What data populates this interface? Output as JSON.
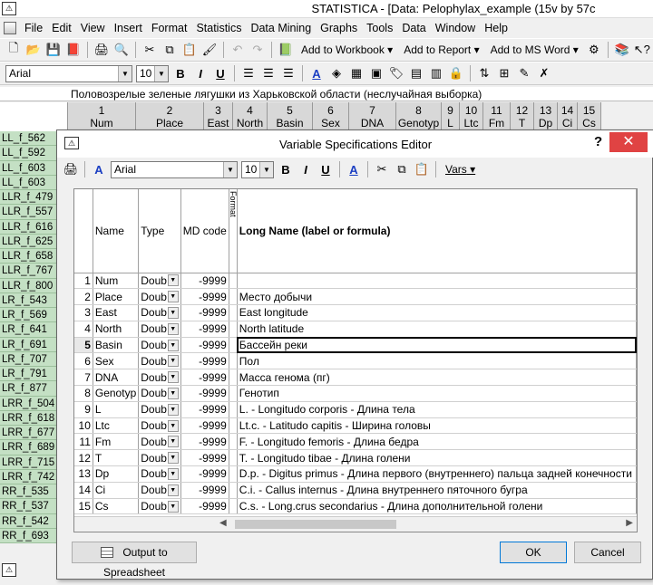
{
  "window": {
    "title": "STATISTICA - [Data: Pelophylax_example (15v by 57c"
  },
  "menu": [
    "File",
    "Edit",
    "View",
    "Insert",
    "Format",
    "Statistics",
    "Data Mining",
    "Graphs",
    "Tools",
    "Data",
    "Window",
    "Help"
  ],
  "toolbar1": {
    "add_workbook": "Add to Workbook",
    "add_report": "Add to Report",
    "add_msword": "Add to MS Word",
    "dropdown_glyph": "▾"
  },
  "toolbar2": {
    "font": "Arial",
    "size": "10",
    "bold": "B",
    "italic": "I",
    "underline": "U",
    "font_color": "A"
  },
  "sheet": {
    "title": "Половозрелые зеленые лягушки из Харьковской области (неслучайная выборка)",
    "columns": [
      {
        "num": "1",
        "name": "Num"
      },
      {
        "num": "2",
        "name": "Place"
      },
      {
        "num": "3",
        "name": "East"
      },
      {
        "num": "4",
        "name": "North"
      },
      {
        "num": "5",
        "name": "Basin"
      },
      {
        "num": "6",
        "name": "Sex"
      },
      {
        "num": "7",
        "name": "DNA"
      },
      {
        "num": "8",
        "name": "Genotyp"
      },
      {
        "num": "9",
        "name": "L"
      },
      {
        "num": "10",
        "name": "Ltc"
      },
      {
        "num": "11",
        "name": "Fm"
      },
      {
        "num": "12",
        "name": "T"
      },
      {
        "num": "13",
        "name": "Dp"
      },
      {
        "num": "14",
        "name": "Ci"
      },
      {
        "num": "15",
        "name": "Cs"
      }
    ],
    "row_labels": [
      "LL_f_562",
      "LL_f_592",
      "LL_f_603",
      "LL_f_603",
      "LLR_f_479",
      "LLR_f_557",
      "LLR_f_616",
      "LLR_f_625",
      "LLR_f_658",
      "LLR_f_767",
      "LLR_f_800",
      "LR_f_543",
      "LR_f_569",
      "LR_f_641",
      "LR_f_691",
      "LR_f_707",
      "LR_f_791",
      "LR_f_877",
      "LRR_f_504",
      "LRR_f_618",
      "LRR_f_677",
      "LRR_f_689",
      "LRR_f_715",
      "LRR_f_742",
      "RR_f_535",
      "RR_f_537",
      "RR_f_542",
      "RR_f_693"
    ]
  },
  "dialog": {
    "title": "Variable Specifications Editor",
    "help": "?",
    "close": "✕",
    "toolbar": {
      "font": "Arial",
      "size": "10",
      "bold": "B",
      "italic": "I",
      "underline": "U",
      "font_color": "A",
      "vars": "Vars"
    },
    "grid": {
      "headers": {
        "name": "Name",
        "type": "Type",
        "md_code": "MD code",
        "narrow": "Format",
        "long_name": "Long Name (label or formula)"
      },
      "rows": [
        {
          "n": "1",
          "name": "Num",
          "type": "Doub",
          "md": "-9999",
          "long": ""
        },
        {
          "n": "2",
          "name": "Place",
          "type": "Doub",
          "md": "-9999",
          "long": "Место добычи"
        },
        {
          "n": "3",
          "name": "East",
          "type": "Doub",
          "md": "-9999",
          "long": "East longitude"
        },
        {
          "n": "4",
          "name": "North",
          "type": "Doub",
          "md": "-9999",
          "long": "North latitude"
        },
        {
          "n": "5",
          "name": "Basin",
          "type": "Doub",
          "md": "-9999",
          "long": "Бассейн реки"
        },
        {
          "n": "6",
          "name": "Sex",
          "type": "Doub",
          "md": "-9999",
          "long": "Пол"
        },
        {
          "n": "7",
          "name": "DNA",
          "type": "Doub",
          "md": "-9999",
          "long": "Масса генома (пг)"
        },
        {
          "n": "8",
          "name": "Genotyp",
          "type": "Doub",
          "md": "-9999",
          "long": "Генотип"
        },
        {
          "n": "9",
          "name": "L",
          "type": "Doub",
          "md": "-9999",
          "long": "L. - Longitudo corporis - Длина тела"
        },
        {
          "n": "10",
          "name": "Ltc",
          "type": "Doub",
          "md": "-9999",
          "long": "Lt.c. - Latitudo capitis - Ширина головы"
        },
        {
          "n": "11",
          "name": "Fm",
          "type": "Doub",
          "md": "-9999",
          "long": "F. - Longitudo femoris - Длина бедра"
        },
        {
          "n": "12",
          "name": "T",
          "type": "Doub",
          "md": "-9999",
          "long": "T. - Longitudo tibae - Длина голени"
        },
        {
          "n": "13",
          "name": "Dp",
          "type": "Doub",
          "md": "-9999",
          "long": "D.p. - Digitus primus - Длина первого (внутреннего) пальца задней конечности"
        },
        {
          "n": "14",
          "name": "Ci",
          "type": "Doub",
          "md": "-9999",
          "long": "C.i. - Callus internus - Длина внутреннего пяточного бугра"
        },
        {
          "n": "15",
          "name": "Cs",
          "type": "Doub",
          "md": "-9999",
          "long": "C.s. - Long.crus secondarius - Длина дополнительной голени"
        }
      ]
    },
    "buttons": {
      "output": "Output to Spreadsheet",
      "ok": "OK",
      "cancel": "Cancel"
    }
  },
  "colors": {
    "row_label_bg": "#c4e0c4",
    "close_red": "#e04343",
    "ok_border": "#0078d7"
  }
}
